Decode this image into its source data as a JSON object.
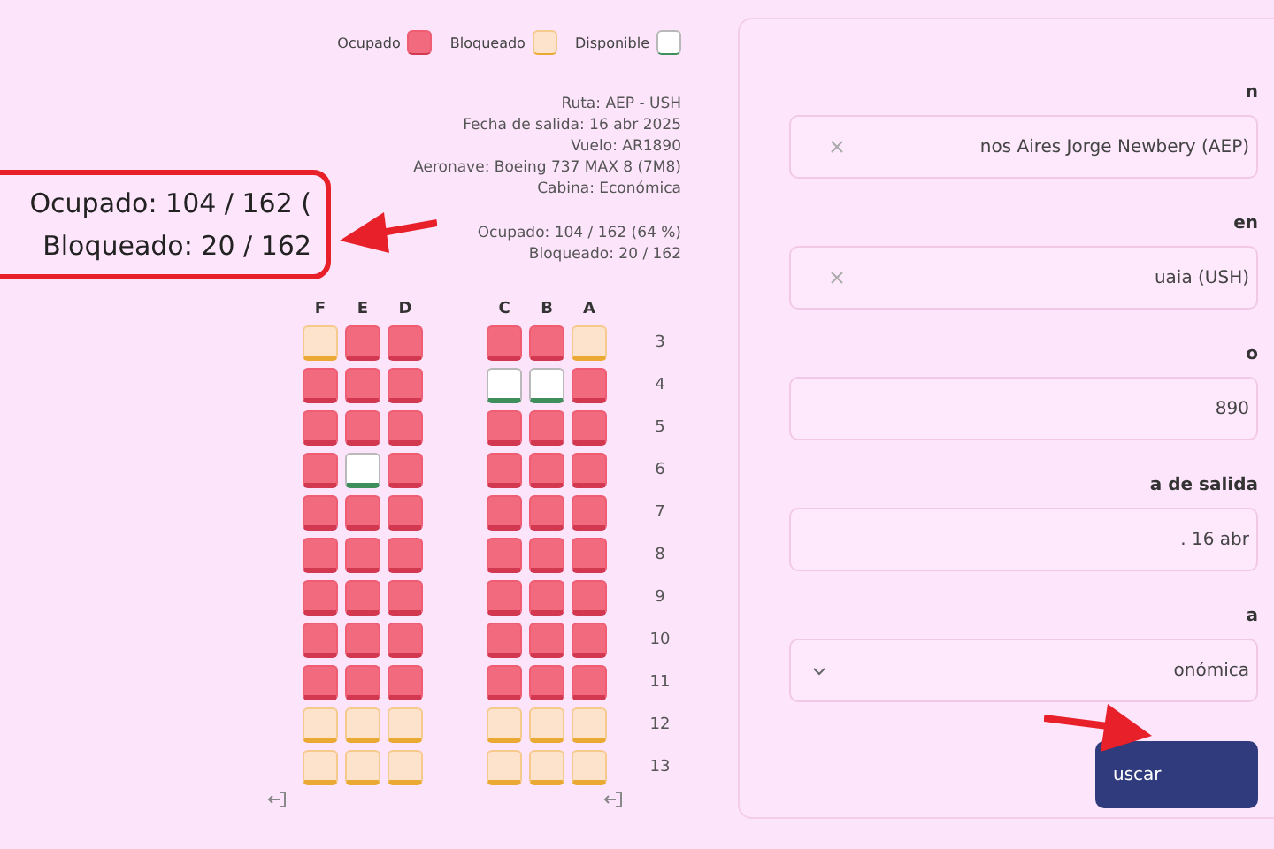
{
  "form": {
    "fields": [
      {
        "label": "n",
        "value": "nos Aires Jorge Newbery (AEP)",
        "kind": "clearable"
      },
      {
        "label": "en",
        "value": "uaia (USH)",
        "kind": "clearable"
      },
      {
        "label": "o",
        "value": "890",
        "kind": "text"
      },
      {
        "label": "a de salida",
        "value": ". 16 abr",
        "kind": "text"
      },
      {
        "label": "a",
        "value": "onómica",
        "kind": "select"
      }
    ],
    "button": "uscar"
  },
  "legend": [
    {
      "label": "Ocupado",
      "kind": "occupied"
    },
    {
      "label": "Bloqueado",
      "kind": "blocked"
    },
    {
      "label": "Disponible",
      "kind": "free"
    }
  ],
  "flight_info": [
    "Ruta: AEP - USH",
    "Fecha de salida: 16 abr 2025",
    "Vuelo: AR1890",
    "Aeronave: Boeing 737 MAX 8 (7M8)",
    "Cabina: Económica"
  ],
  "counts": [
    "Ocupado: 104 / 162 (64 %)",
    "Bloqueado: 20 / 162"
  ],
  "callout": [
    "Ocupado: 104 / 162 (",
    "Bloqueado: 20 / 162"
  ],
  "seat_map": {
    "columns": [
      "F",
      "E",
      "D",
      "C",
      "B",
      "A"
    ],
    "rows": [
      {
        "number": "3",
        "exit": false,
        "seats": [
          {
            "kind": "blocked"
          },
          {
            "kind": "occupied"
          },
          {
            "kind": "occupied"
          },
          {
            "kind": "occupied"
          },
          {
            "kind": "occupied"
          },
          {
            "kind": "blocked"
          }
        ]
      },
      {
        "number": "4",
        "exit": false,
        "seats": [
          {
            "kind": "occupied"
          },
          {
            "kind": "occupied"
          },
          {
            "kind": "occupied"
          },
          {
            "kind": "free"
          },
          {
            "kind": "free"
          },
          {
            "kind": "occupied"
          }
        ]
      },
      {
        "number": "5",
        "exit": false,
        "seats": [
          {
            "kind": "occupied"
          },
          {
            "kind": "occupied"
          },
          {
            "kind": "occupied"
          },
          {
            "kind": "occupied"
          },
          {
            "kind": "occupied"
          },
          {
            "kind": "occupied"
          }
        ]
      },
      {
        "number": "6",
        "exit": false,
        "seats": [
          {
            "kind": "occupied"
          },
          {
            "kind": "free"
          },
          {
            "kind": "occupied"
          },
          {
            "kind": "occupied"
          },
          {
            "kind": "occupied"
          },
          {
            "kind": "occupied"
          }
        ]
      },
      {
        "number": "7",
        "exit": false,
        "seats": [
          {
            "kind": "occupied"
          },
          {
            "kind": "occupied"
          },
          {
            "kind": "occupied"
          },
          {
            "kind": "occupied"
          },
          {
            "kind": "occupied"
          },
          {
            "kind": "occupied"
          }
        ]
      },
      {
        "number": "8",
        "exit": false,
        "seats": [
          {
            "kind": "occupied"
          },
          {
            "kind": "occupied"
          },
          {
            "kind": "occupied"
          },
          {
            "kind": "occupied"
          },
          {
            "kind": "occupied"
          },
          {
            "kind": "occupied"
          }
        ]
      },
      {
        "number": "9",
        "exit": false,
        "seats": [
          {
            "kind": "occupied"
          },
          {
            "kind": "occupied"
          },
          {
            "kind": "occupied"
          },
          {
            "kind": "occupied"
          },
          {
            "kind": "occupied"
          },
          {
            "kind": "occupied"
          }
        ]
      },
      {
        "number": "10",
        "exit": false,
        "seats": [
          {
            "kind": "occupied"
          },
          {
            "kind": "occupied"
          },
          {
            "kind": "occupied"
          },
          {
            "kind": "occupied"
          },
          {
            "kind": "occupied"
          },
          {
            "kind": "occupied"
          }
        ]
      },
      {
        "number": "11",
        "exit": false,
        "seats": [
          {
            "kind": "occupied"
          },
          {
            "kind": "occupied"
          },
          {
            "kind": "occupied"
          },
          {
            "kind": "occupied"
          },
          {
            "kind": "occupied"
          },
          {
            "kind": "occupied"
          }
        ]
      },
      {
        "number": "12",
        "exit": false,
        "seats": [
          {
            "kind": "blocked"
          },
          {
            "kind": "blocked"
          },
          {
            "kind": "blocked"
          },
          {
            "kind": "blocked"
          },
          {
            "kind": "blocked"
          },
          {
            "kind": "blocked"
          }
        ]
      },
      {
        "number": "13",
        "exit": true,
        "seats": [
          {
            "kind": "blocked"
          },
          {
            "kind": "blocked"
          },
          {
            "kind": "blocked"
          },
          {
            "kind": "blocked"
          },
          {
            "kind": "blocked"
          },
          {
            "kind": "blocked"
          }
        ]
      }
    ]
  }
}
